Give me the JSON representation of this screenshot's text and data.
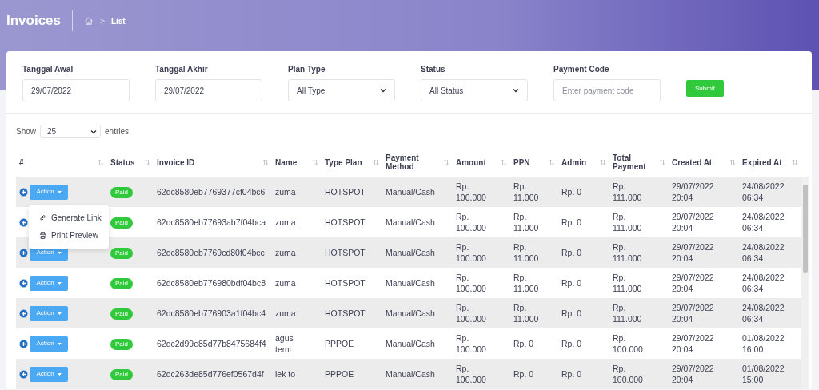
{
  "header": {
    "title": "Invoices",
    "breadcrumb": {
      "separator": ">",
      "current": "List"
    }
  },
  "filters": [
    {
      "kind": "text",
      "label": "Tanggal Awal",
      "value": "29/07/2022"
    },
    {
      "kind": "text",
      "label": "Tanggal Akhir",
      "value": "29/07/2022"
    },
    {
      "kind": "select",
      "label": "Plan Type",
      "value": "All Type"
    },
    {
      "kind": "select",
      "label": "Status",
      "value": "All Status"
    },
    {
      "kind": "text",
      "label": "Payment Code",
      "placeholder": "Enter payment code"
    }
  ],
  "submit": "Submit",
  "length_menu": {
    "before": "Show",
    "value": "25",
    "after": "entries"
  },
  "table": {
    "columns": [
      "#",
      "Status",
      "Invoice ID",
      "Name",
      "Type Plan",
      "Payment Method",
      "Amount",
      "PPN",
      "Admin",
      "Total Payment",
      "Created At",
      "Expired At"
    ],
    "action_menu": [
      {
        "kind": "link",
        "label": "Generate Link"
      },
      {
        "kind": "print",
        "label": "Print Preview"
      }
    ],
    "rows": [
      {
        "action": "Action",
        "menu_open": true,
        "status": "Paid",
        "invoice_id": "62dc8580eb7769377cf04bc6",
        "name": "zuma",
        "type_plan": "HOTSPOT",
        "method": "Manual/Cash",
        "amount": "Rp. 100.000",
        "ppn": "Rp. 11.000",
        "admin": "Rp. 0",
        "total": "Rp. 111.000",
        "created": "29/07/2022 20:04",
        "expired": "24/08/2022 06:34"
      },
      {
        "menu_open": false,
        "status": "Paid",
        "invoice_id": "62dc8580eb77693ab7f04bca",
        "name": "zuma",
        "type_plan": "HOTSPOT",
        "method": "Manual/Cash",
        "amount": "Rp. 100.000",
        "ppn": "Rp. 11.000",
        "admin": "Rp. 0",
        "total": "Rp. 111.000",
        "created": "29/07/2022 20:04",
        "expired": "24/08/2022 06:34"
      },
      {
        "action": "Action",
        "menu_open": false,
        "status": "Paid",
        "invoice_id": "62dc8580eb7769cd80f04bcc",
        "name": "zuma",
        "type_plan": "HOTSPOT",
        "method": "Manual/Cash",
        "amount": "Rp. 100.000",
        "ppn": "Rp. 11.000",
        "admin": "Rp. 0",
        "total": "Rp. 111.000",
        "created": "29/07/2022 20:04",
        "expired": "24/08/2022 06:34"
      },
      {
        "action": "Action",
        "menu_open": false,
        "status": "Paid",
        "invoice_id": "62dc8580eb776980bdf04bc8",
        "name": "zuma",
        "type_plan": "HOTSPOT",
        "method": "Manual/Cash",
        "amount": "Rp. 100.000",
        "ppn": "Rp. 11.000",
        "admin": "Rp. 0",
        "total": "Rp. 111.000",
        "created": "29/07/2022 20:04",
        "expired": "24/08/2022 06:34"
      },
      {
        "action": "Action",
        "menu_open": false,
        "status": "Paid",
        "invoice_id": "62dc8580eb776903a1f04bc4",
        "name": "zuma",
        "type_plan": "HOTSPOT",
        "method": "Manual/Cash",
        "amount": "Rp. 100.000",
        "ppn": "Rp. 11.000",
        "admin": "Rp. 0",
        "total": "Rp. 111.000",
        "created": "29/07/2022 20:04",
        "expired": "24/08/2022 06:34"
      },
      {
        "action": "Action",
        "menu_open": false,
        "status": "Paid",
        "invoice_id": "62dc2d99e85d77b8475684f4",
        "name": "agus temi",
        "type_plan": "PPPOE",
        "method": "Manual/Cash",
        "amount": "Rp. 100.000",
        "ppn": "Rp. 0",
        "admin": "Rp. 0",
        "total": "Rp. 100.000",
        "created": "29/07/2022 20:04",
        "expired": "01/08/2022 16:00"
      },
      {
        "action": "Action",
        "menu_open": false,
        "status": "Paid",
        "invoice_id": "62dc263de85d776ef0567d4f",
        "name": "lek to",
        "type_plan": "PPPOE",
        "method": "Manual/Cash",
        "amount": "Rp. 100.000",
        "ppn": "Rp. 0",
        "admin": "Rp. 0",
        "total": "Rp. 100.000",
        "created": "29/07/2022 20:04",
        "expired": "01/08/2022 15:00"
      }
    ]
  }
}
